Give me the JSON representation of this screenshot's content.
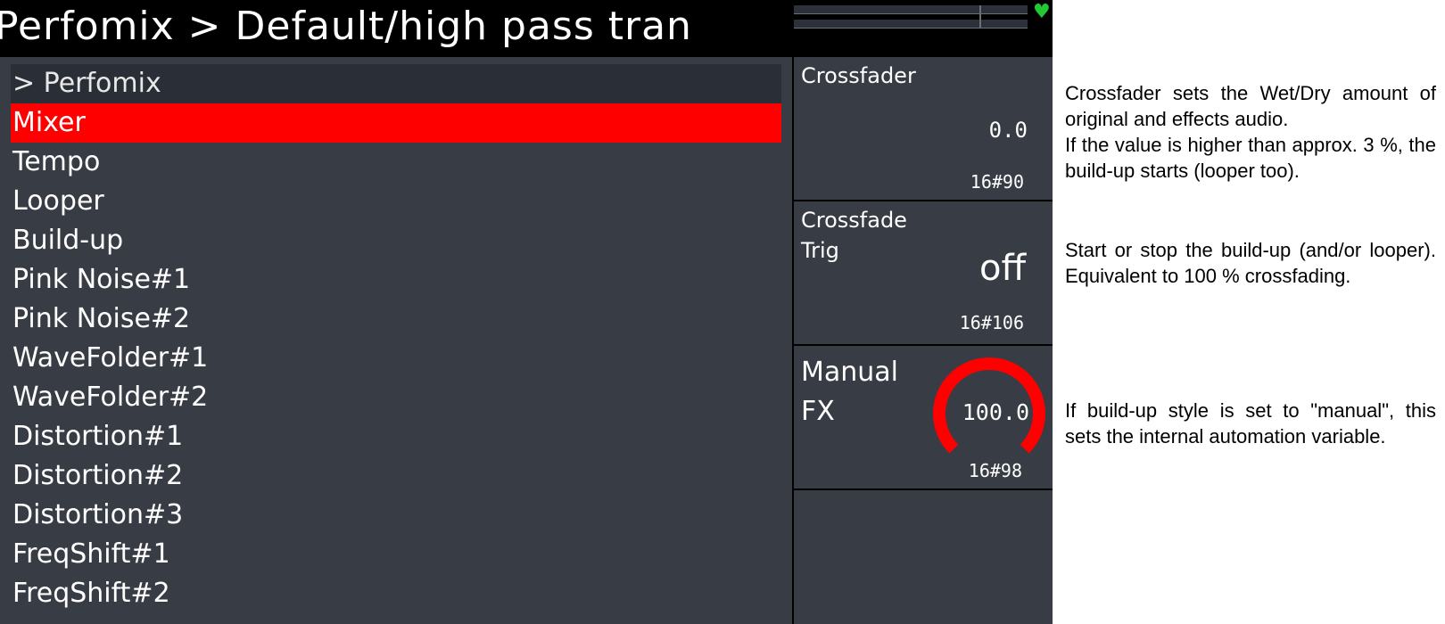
{
  "title": "Perfomix > Default/high pass tran",
  "status": {
    "heart_icon": "heart-icon",
    "heart_color": "#22c933"
  },
  "menu": {
    "items": [
      {
        "label": "> Perfomix",
        "state": "header"
      },
      {
        "label": "Mixer",
        "state": "selected"
      },
      {
        "label": "Tempo",
        "state": "normal"
      },
      {
        "label": "Looper",
        "state": "normal"
      },
      {
        "label": "Build-up",
        "state": "normal"
      },
      {
        "label": "Pink Noise#1",
        "state": "normal"
      },
      {
        "label": "Pink Noise#2",
        "state": "normal"
      },
      {
        "label": "WaveFolder#1",
        "state": "normal"
      },
      {
        "label": "WaveFolder#2",
        "state": "normal"
      },
      {
        "label": "Distortion#1",
        "state": "normal"
      },
      {
        "label": "Distortion#2",
        "state": "normal"
      },
      {
        "label": "Distortion#3",
        "state": "normal"
      },
      {
        "label": "FreqShift#1",
        "state": "normal"
      },
      {
        "label": "FreqShift#2",
        "state": "normal"
      }
    ],
    "selected_color": "#ff0000"
  },
  "params": [
    {
      "name": "Crossfader",
      "value": "0.0",
      "cc": "16#90"
    },
    {
      "name": "Crossfade\nTrig",
      "value": "off",
      "cc": "16#106"
    },
    {
      "name": "Manual\nFX",
      "value": "100.0",
      "cc": "16#98",
      "knob_level": 1.0,
      "knob_color": "#ff0000"
    }
  ],
  "descriptions": [
    "Crossfader sets the Wet/Dry amount of original and effects audio.\nIf the value is higher than approx. 3 %, the build-up starts (looper too).",
    "Start or stop the build-up (and/or looper). Equivalent to 100 % crossfading.",
    "If build-up style is set to \"manual\", this sets the internal automation variable."
  ]
}
